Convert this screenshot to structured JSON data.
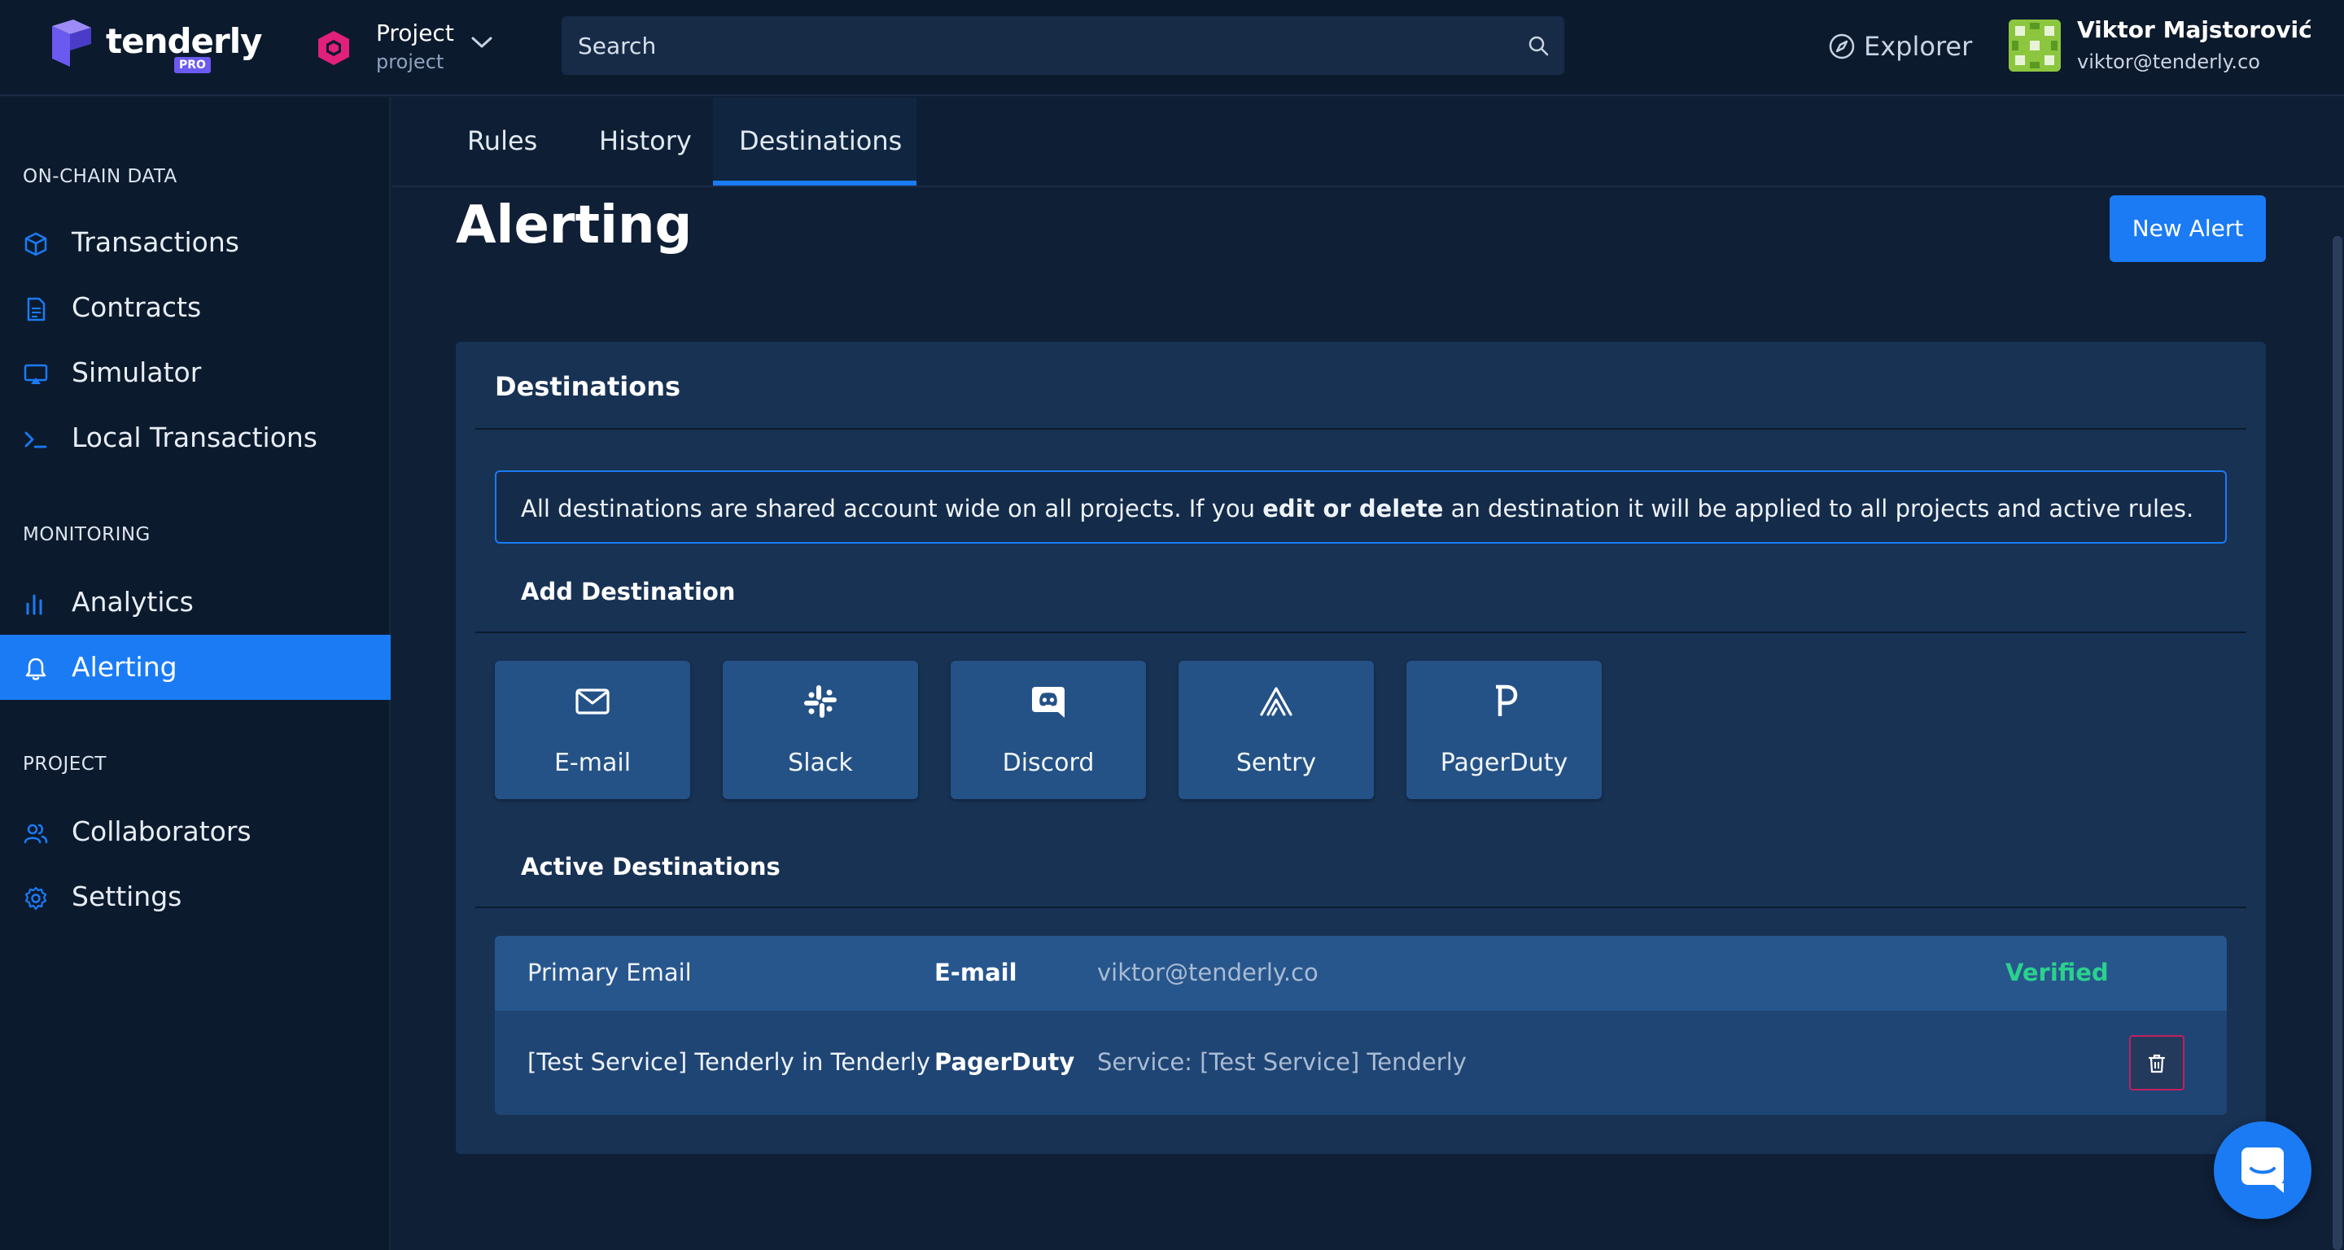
{
  "app": {
    "logo_text": "tenderly",
    "plan_badge": "PRO"
  },
  "project": {
    "name": "Project",
    "slug": "project"
  },
  "search": {
    "placeholder": "Search"
  },
  "header": {
    "explorer_label": "Explorer",
    "user_name": "Viktor Majstorović",
    "user_email": "viktor@tenderly.co"
  },
  "sidebar": {
    "sections": [
      {
        "title": "ON-CHAIN DATA",
        "items": [
          {
            "label": "Transactions",
            "icon": "cube-icon"
          },
          {
            "label": "Contracts",
            "icon": "document-icon"
          },
          {
            "label": "Simulator",
            "icon": "screen-icon"
          },
          {
            "label": "Local Transactions",
            "icon": "terminal-icon"
          }
        ]
      },
      {
        "title": "MONITORING",
        "items": [
          {
            "label": "Analytics",
            "icon": "bar-chart-icon"
          },
          {
            "label": "Alerting",
            "icon": "bell-icon",
            "active": true
          }
        ]
      },
      {
        "title": "PROJECT",
        "items": [
          {
            "label": "Collaborators",
            "icon": "users-icon"
          },
          {
            "label": "Settings",
            "icon": "gear-icon"
          }
        ]
      }
    ]
  },
  "tabs": [
    {
      "label": "Rules"
    },
    {
      "label": "History"
    },
    {
      "label": "Destinations",
      "active": true
    }
  ],
  "page": {
    "title": "Alerting",
    "new_alert_label": "New Alert"
  },
  "destinations": {
    "card_title": "Destinations",
    "notice": {
      "before": "All destinations are shared account wide on all projects. If you ",
      "bold": "edit or delete",
      "after": " an destination it will be applied to all projects and active rules."
    },
    "add_heading": "Add Destination",
    "options": [
      {
        "label": "E-mail",
        "icon": "mail-icon"
      },
      {
        "label": "Slack",
        "icon": "slack-icon"
      },
      {
        "label": "Discord",
        "icon": "discord-icon"
      },
      {
        "label": "Sentry",
        "icon": "sentry-icon"
      },
      {
        "label": "PagerDuty",
        "icon": "pagerduty-icon"
      }
    ],
    "active_heading": "Active Destinations",
    "active": [
      {
        "name": "Primary Email",
        "type": "E-mail",
        "value": "viktor@tenderly.co",
        "status": "Verified"
      },
      {
        "name": "[Test Service] Tenderly in Tenderly",
        "type": "PagerDuty",
        "value": "Service: [Test Service] Tenderly",
        "status": ""
      }
    ]
  },
  "colors": {
    "accent": "#1a7bf5",
    "sidebar_bg": "#0c1a2d",
    "card_bg": "#183254",
    "verified": "#2bd18c",
    "delete_border": "#c02060"
  }
}
